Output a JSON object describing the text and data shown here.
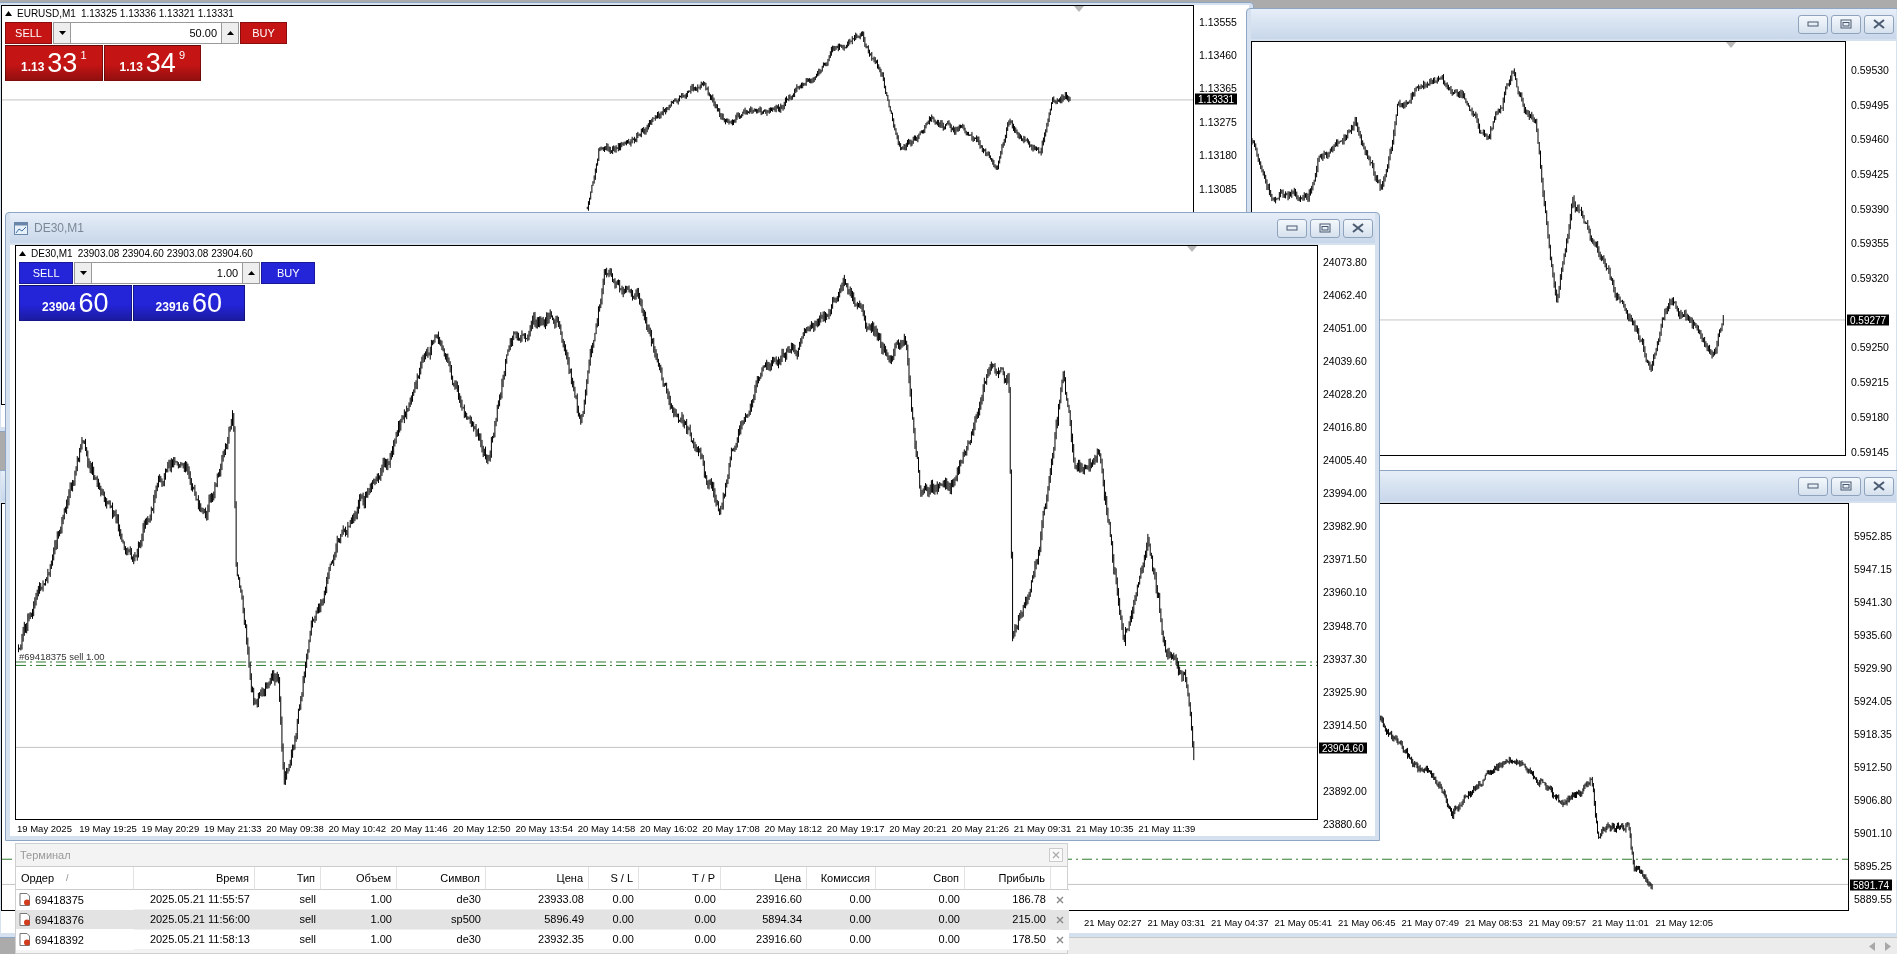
{
  "chart_windows": [
    {
      "symbol": "EURUSD,M1",
      "ohlc": "1.13325 1.13336 1.13321 1.13331",
      "trade_panel": {
        "color": "#c41414",
        "sell_label": "SELL",
        "buy_label": "BUY",
        "lot": "50.00",
        "sell_price": {
          "prefix": "1.13",
          "pips": "33",
          "fraction": "1"
        },
        "buy_price": {
          "prefix": "1.13",
          "pips": "34",
          "fraction": "9"
        }
      },
      "price_axis": [
        "1.13555",
        "1.13460",
        "1.13365",
        "1.13275",
        "1.13180",
        "1.13085"
      ],
      "current_price": "1.13331"
    },
    {
      "price_axis": [
        "0.59530",
        "0.59495",
        "0.59460",
        "0.59425",
        "0.59390",
        "0.59355",
        "0.59320",
        "0.59250",
        "0.59215",
        "0.59180",
        "0.59145"
      ],
      "current_price": "0.59277"
    },
    {
      "price_axis": [
        "5952.85",
        "5947.15",
        "5941.30",
        "5935.60",
        "5929.90",
        "5924.05",
        "5918.35",
        "5912.50",
        "5906.80",
        "5901.10",
        "5895.25",
        "5889.55"
      ],
      "current_price": "5891.74",
      "time_axis": [
        "21 May 02:27",
        "21 May 03:31",
        "21 May 04:37",
        "21 May 05:41",
        "21 May 06:45",
        "21 May 07:49",
        "21 May 08:53",
        "21 May 09:57",
        "21 May 11:01",
        "21 May 12:05"
      ]
    },
    {
      "title": "DE30,M1",
      "symbol": "DE30,M1",
      "ohlc": "23903.08 23904.60 23903.08 23904.60",
      "trade_panel": {
        "color": "#2424d8",
        "sell_label": "SELL",
        "buy_label": "BUY",
        "lot": "1.00",
        "sell_price": {
          "prefix": "23904",
          "pips": "60"
        },
        "buy_price": {
          "prefix": "23916",
          "pips": "60"
        }
      },
      "price_axis": [
        "24073.80",
        "24062.40",
        "24051.00",
        "24039.60",
        "24028.20",
        "24016.80",
        "24005.40",
        "23994.00",
        "23982.90",
        "23971.50",
        "23960.10",
        "23948.70",
        "23937.30",
        "23925.90",
        "23914.50",
        "23892.00",
        "23880.60"
      ],
      "current_price": "23904.60",
      "order_labels": [
        "#69418375 sell 1.00"
      ],
      "time_axis": [
        "19 May 2025",
        "19 May 19:25",
        "19 May 20:29",
        "19 May 21:33",
        "20 May 09:38",
        "20 May 10:42",
        "20 May 11:46",
        "20 May 12:50",
        "20 May 13:54",
        "20 May 14:58",
        "20 May 16:02",
        "20 May 17:08",
        "20 May 18:12",
        "20 May 19:17",
        "20 May 20:21",
        "20 May 21:26",
        "21 May 09:31",
        "21 May 10:35",
        "21 May 11:39"
      ]
    }
  ],
  "terminal": {
    "title": "Терминал",
    "sort_indicator": "/",
    "columns": [
      "Ордер",
      "Время",
      "Тип",
      "Объем",
      "Символ",
      "Цена",
      "S / L",
      "T / P",
      "Цена",
      "Комиссия",
      "Своп",
      "Прибыль"
    ],
    "rows": [
      {
        "selected": false,
        "cells": [
          "69418375",
          "2025.05.21 11:55:57",
          "sell",
          "1.00",
          "de30",
          "23933.08",
          "0.00",
          "0.00",
          "23916.60",
          "0.00",
          "0.00",
          "186.78"
        ]
      },
      {
        "selected": true,
        "cells": [
          "69418376",
          "2025.05.21 11:56:00",
          "sell",
          "1.00",
          "sp500",
          "5896.49",
          "0.00",
          "0.00",
          "5894.34",
          "0.00",
          "0.00",
          "215.00"
        ]
      },
      {
        "selected": false,
        "cells": [
          "69418392",
          "2025.05.21 11:58:13",
          "sell",
          "1.00",
          "de30",
          "23932.35",
          "0.00",
          "0.00",
          "23916.60",
          "0.00",
          "0.00",
          "178.50"
        ]
      }
    ]
  }
}
